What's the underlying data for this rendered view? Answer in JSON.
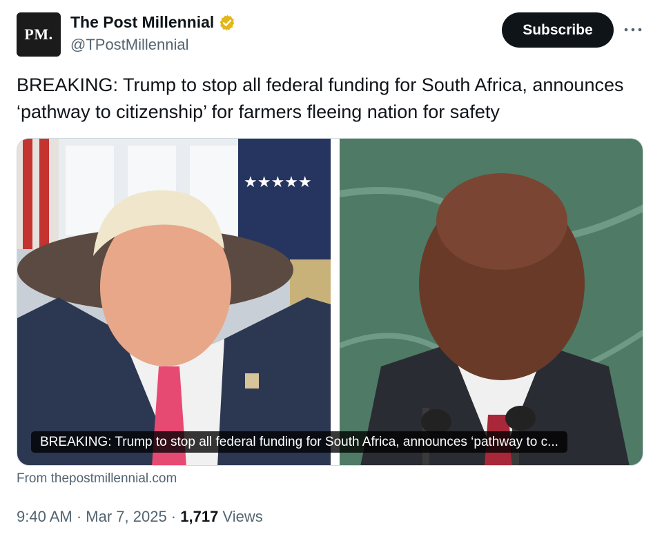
{
  "account": {
    "avatar_text": "PM.",
    "display_name": "The Post Millennial",
    "handle": "@TPostMillennial",
    "verified_badge_color": "#e2b719"
  },
  "actions": {
    "subscribe_label": "Subscribe",
    "more_icon": "more-horizontal-icon"
  },
  "tweet": {
    "text": "BREAKING: Trump to stop all federal funding for South Africa, announces ‘pathway to citizenship’ for farmers fleeing nation for safety"
  },
  "media": {
    "caption": "BREAKING: Trump to stop all federal funding for South Africa, announces ‘pathway to c...",
    "source": "From thepostmillennial.com"
  },
  "meta": {
    "time": "9:40 AM",
    "separator": " · ",
    "date": "Mar 7, 2025",
    "views_count": "1,717",
    "views_label": " Views"
  },
  "colors": {
    "text_primary": "#0f1419",
    "text_secondary": "#536471",
    "button_bg": "#0f1419"
  }
}
